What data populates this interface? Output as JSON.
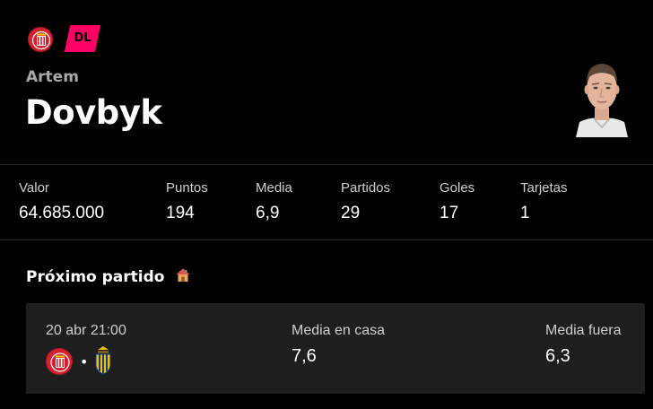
{
  "player": {
    "position": "DL",
    "first_name": "Artem",
    "last_name": "Dovbyk"
  },
  "stats": [
    {
      "label": "Valor",
      "value": "64.685.000"
    },
    {
      "label": "Puntos",
      "value": "194"
    },
    {
      "label": "Media",
      "value": "6,9"
    },
    {
      "label": "Partidos",
      "value": "29"
    },
    {
      "label": "Goles",
      "value": "17"
    },
    {
      "label": "Tarjetas",
      "value": "1"
    }
  ],
  "next_match": {
    "title": "Próximo partido",
    "date": "20 abr 21:00",
    "separator": "•",
    "home_avg_label": "Media en casa",
    "home_avg_value": "7,6",
    "away_avg_label": "Media fuera",
    "away_avg_value": "6,3"
  },
  "colors": {
    "accent": "#ff0066",
    "club_red": "#d6202f",
    "card_bg": "#1e1e1e"
  },
  "icons": {
    "club": "girona-crest-icon",
    "home": "house-icon",
    "opponent": "cadiz-crest-icon"
  }
}
